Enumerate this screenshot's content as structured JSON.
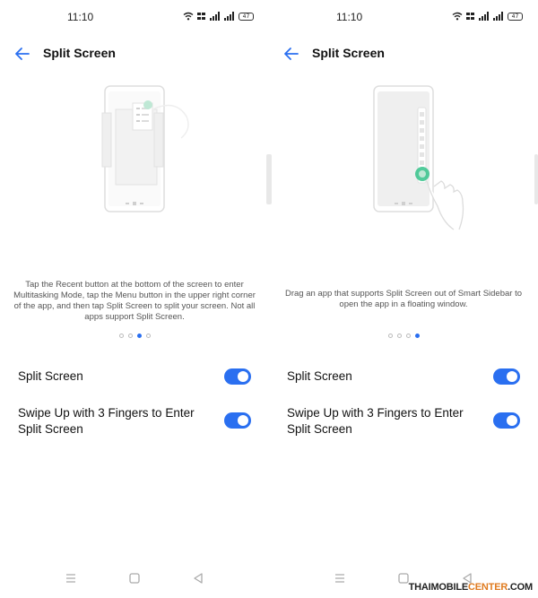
{
  "panels": [
    {
      "status": {
        "time": "11:10",
        "battery": "47"
      },
      "title": "Split Screen",
      "description": "Tap the Recent button at the bottom of the screen to enter Multitasking Mode, tap the Menu button in the upper right corner of the app, and then tap Split Screen to split your screen. Not all apps support Split Screen.",
      "pager": {
        "total": 4,
        "current": 3
      },
      "settings": [
        {
          "label": "Split Screen",
          "enabled": true
        },
        {
          "label": "Swipe Up with 3 Fingers to Enter Split Screen",
          "enabled": true
        }
      ]
    },
    {
      "status": {
        "time": "11:10",
        "battery": "47"
      },
      "title": "Split Screen",
      "description": "Drag an app that supports Split Screen out of Smart Sidebar to open the app in a floating window.",
      "pager": {
        "total": 4,
        "current": 4
      },
      "settings": [
        {
          "label": "Split Screen",
          "enabled": true
        },
        {
          "label": "Swipe Up with 3 Fingers to Enter Split Screen",
          "enabled": true
        }
      ]
    }
  ],
  "icons": {
    "back": "arrow-left-icon",
    "wifi": "wifi-icon",
    "signal": "signal-icon",
    "battery": "battery-icon",
    "menu": "menu-icon",
    "home": "home-icon",
    "nav_back": "triangle-back-icon"
  },
  "colors": {
    "accent": "#2a6ff0",
    "toggle_on": "#2a6ff0",
    "finger_dot": "#34c28a"
  },
  "watermark": {
    "brand": "THAIMOBILE",
    "accent": "CENTER",
    "suffix": ".COM"
  }
}
